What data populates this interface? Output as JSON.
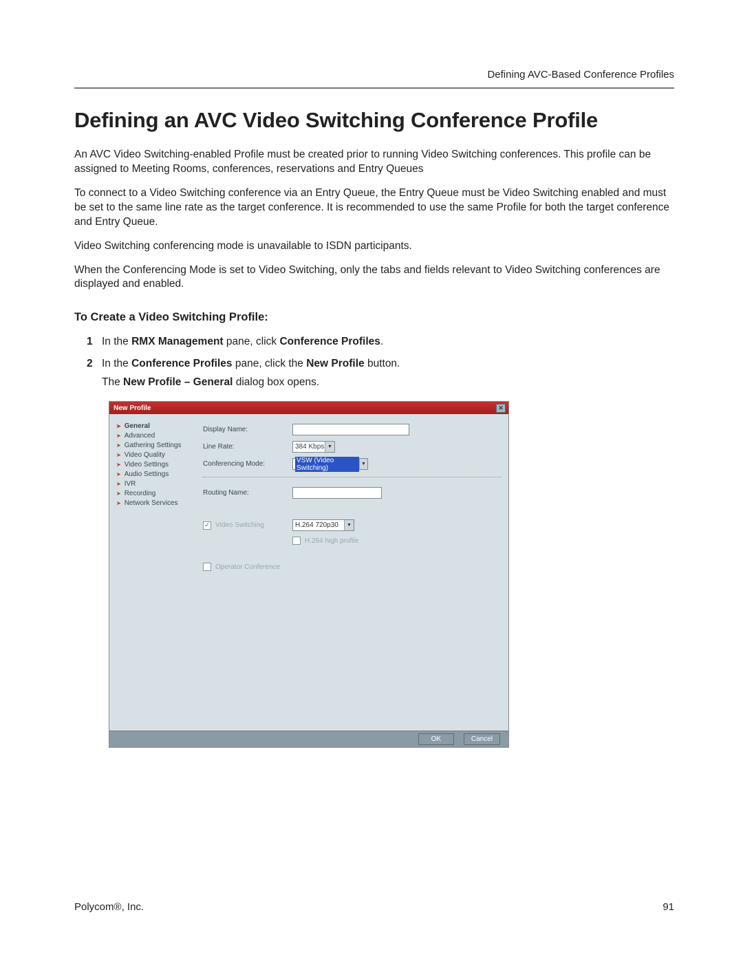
{
  "header": {
    "section_title": "Defining AVC-Based Conference Profiles"
  },
  "page": {
    "title": "Defining an AVC Video Switching Conference Profile",
    "p1": "An AVC Video Switching-enabled Profile must be created prior to running Video Switching conferences. This profile can be assigned to Meeting Rooms, conferences, reservations and Entry Queues",
    "p2": "To connect to a Video Switching conference via an Entry Queue, the Entry Queue must be Video Switching enabled and must be set to the same line rate as the target conference. It is recommended to use the same Profile for both the target conference and Entry Queue.",
    "p3": "Video Switching conferencing mode is unavailable to ISDN participants.",
    "p4": "When the Conferencing Mode is set to Video Switching, only the tabs and fields relevant to Video Switching conferences are displayed and enabled.",
    "subheading": "To Create a Video Switching Profile:",
    "step1_pre": "In the ",
    "step1_b1": "RMX Management",
    "step1_mid": " pane, click ",
    "step1_b2": "Conference Profiles",
    "step1_post": ".",
    "step2_pre": "In the ",
    "step2_b1": "Conference Profiles",
    "step2_mid": " pane, click the ",
    "step2_b2": "New Profile",
    "step2_post": " button.",
    "step2_after_pre": "The ",
    "step2_after_b": "New Profile – General",
    "step2_after_post": " dialog box opens."
  },
  "dialog": {
    "title": "New Profile",
    "sidebar": [
      "General",
      "Advanced",
      "Gathering Settings",
      "Video Quality",
      "Video Settings",
      "Audio Settings",
      "IVR",
      "Recording",
      "Network Services"
    ],
    "fields": {
      "display_name_label": "Display Name:",
      "display_name_value": "",
      "line_rate_label": "Line Rate:",
      "line_rate_value": "384 Kbps",
      "conf_mode_label": "Conferencing Mode:",
      "conf_mode_value": "VSW (Video Switching)",
      "routing_name_label": "Routing Name:",
      "routing_name_value": "",
      "video_switching_label": "Video Switching",
      "video_switching_checked": true,
      "vs_codec_value": "H.264 720p30",
      "h264_high_label": "H.264 high profile",
      "h264_high_checked": false,
      "operator_conf_label": "Operator Conference",
      "operator_conf_checked": false
    },
    "buttons": {
      "ok": "OK",
      "cancel": "Cancel"
    }
  },
  "footer": {
    "left": "Polycom®, Inc.",
    "right": "91"
  }
}
